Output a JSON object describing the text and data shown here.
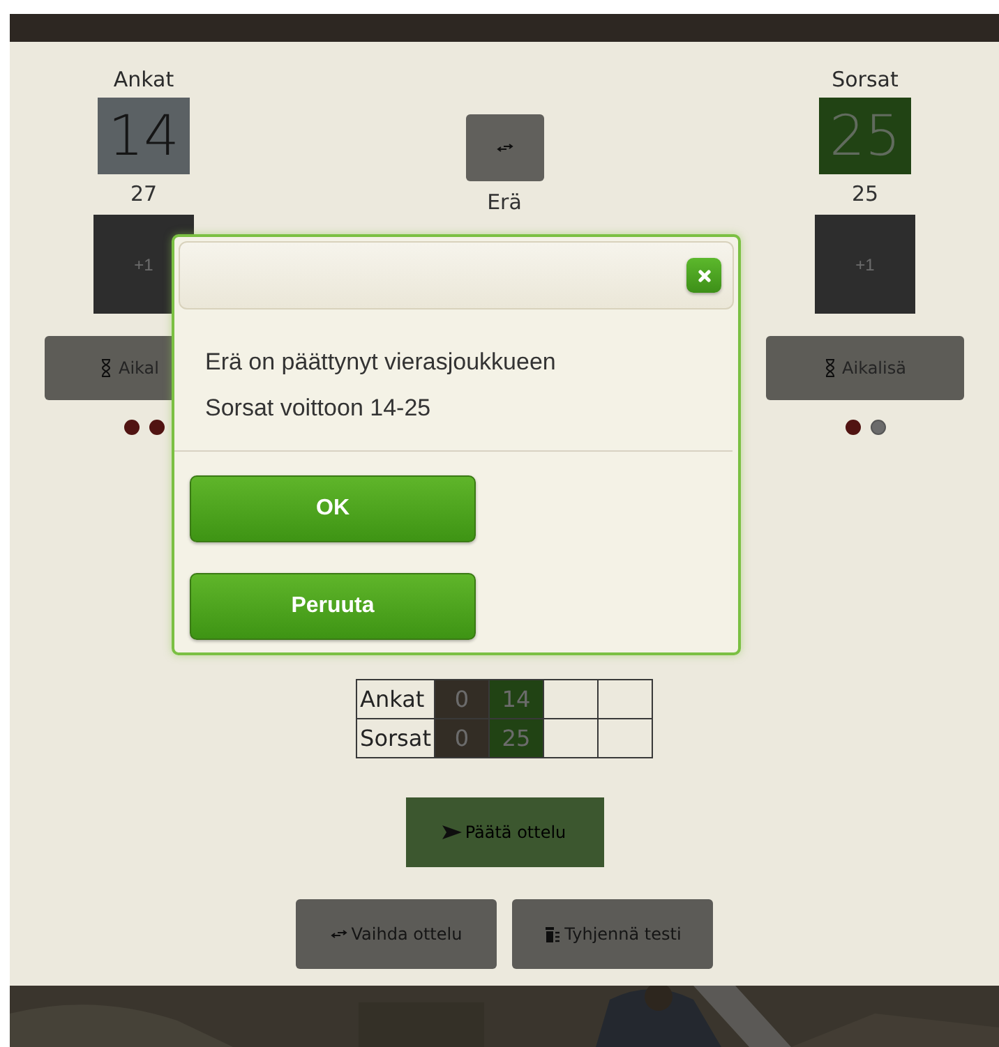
{
  "teams": [
    {
      "name": "Ankat",
      "score": "14",
      "total": "27",
      "add_label": "+1",
      "timeout_label": "Aikal",
      "winner": false,
      "timeouts": [
        {
          "used": true
        },
        {
          "used": true
        }
      ]
    },
    {
      "name": "Sorsat",
      "score": "25",
      "total": "25",
      "add_label": "+1",
      "timeout_label": "Aikalisä",
      "winner": true,
      "timeouts": [
        {
          "used": true
        },
        {
          "used": false
        }
      ]
    }
  ],
  "center": {
    "set_label": "Erä"
  },
  "table": {
    "rows": [
      {
        "team": "Ankat",
        "cells": [
          {
            "kind": "sets",
            "value": "0"
          },
          {
            "kind": "won",
            "value": "14"
          },
          {
            "kind": "empty"
          },
          {
            "kind": "empty"
          }
        ]
      },
      {
        "team": "Sorsat",
        "cells": [
          {
            "kind": "sets",
            "value": "0"
          },
          {
            "kind": "won",
            "value": "25"
          },
          {
            "kind": "empty"
          },
          {
            "kind": "empty"
          }
        ]
      }
    ]
  },
  "end_match_button": "Päätä ottelu",
  "actions": [
    {
      "kind": "swap",
      "label": "Vaihda ottelu"
    },
    {
      "kind": "clear",
      "label": "Tyhjennä testi"
    }
  ],
  "dialog": {
    "message": "Erä on päättynyt vierasjoukkueen Sorsat voittoon 14-25",
    "buttons": [
      "OK",
      "Peruuta"
    ]
  }
}
